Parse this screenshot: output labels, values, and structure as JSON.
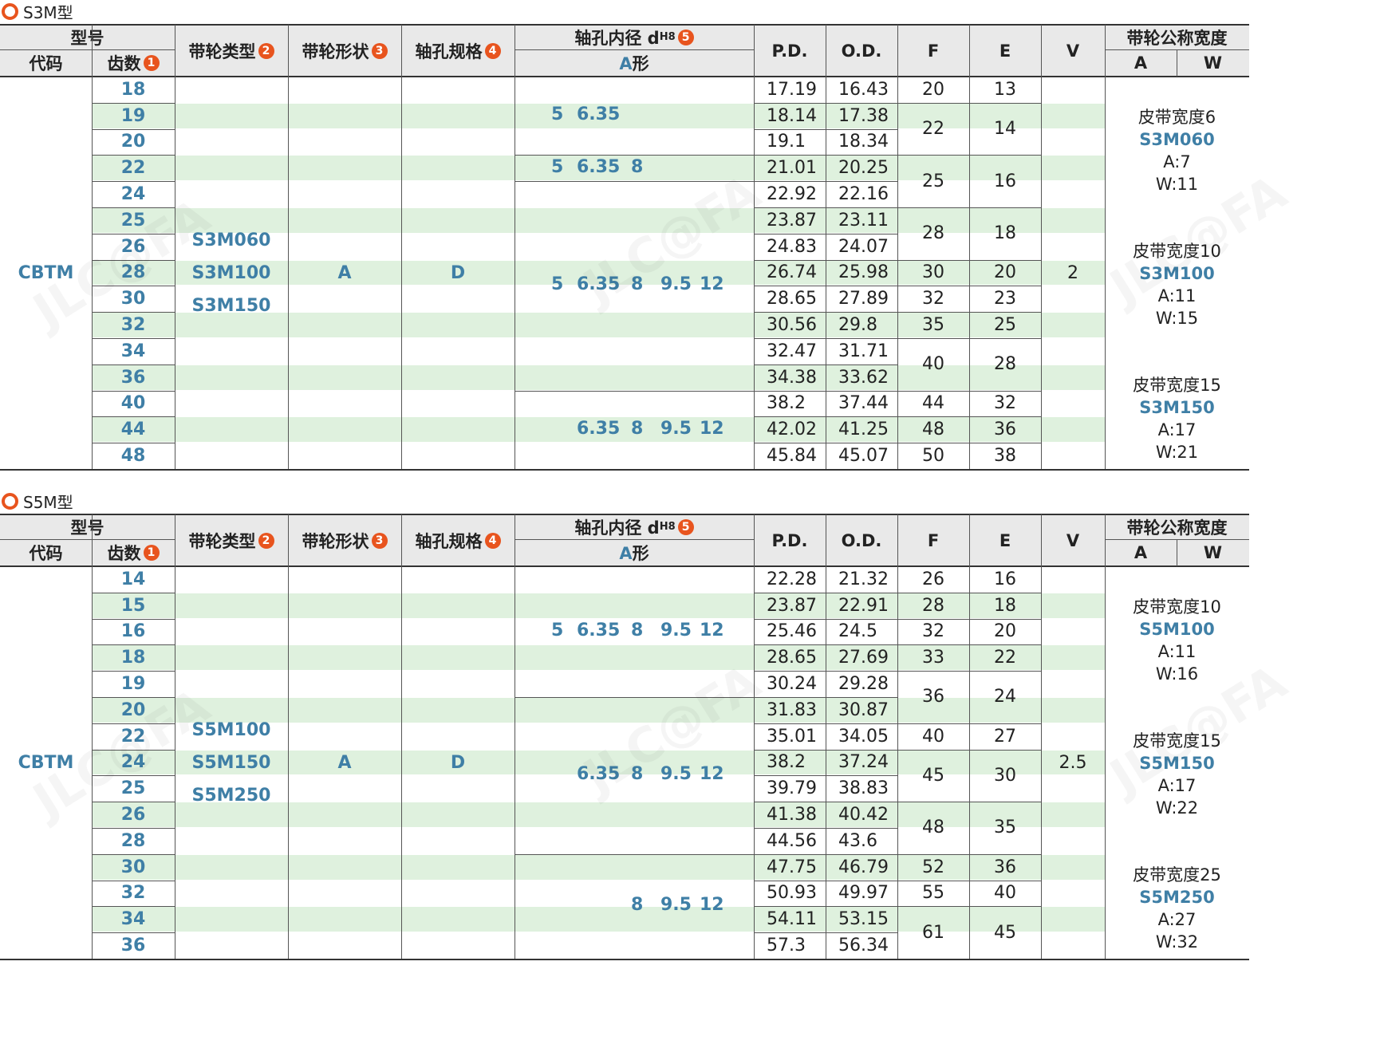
{
  "sections": [
    {
      "title": "S3M型",
      "header": {
        "model": "型号",
        "code": "代码",
        "teeth": "齿数",
        "pulley_type": "带轮类型",
        "pulley_shape": "带轮形状",
        "shaft_spec": "轴孔规格",
        "bore": "轴孔内径 d",
        "bore_sub": "H8",
        "a_shape": "A形",
        "pd": "P.D.",
        "od": "O.D.",
        "f": "F",
        "e": "E",
        "v": "V",
        "nominal_width": "带轮公称宽度",
        "a": "A",
        "w": "W",
        "n1": "1",
        "n2": "2",
        "n3": "3",
        "n4": "4",
        "n5": "5"
      },
      "code": "CBTM",
      "types": [
        "S3M060",
        "S3M100",
        "S3M150"
      ],
      "shape": "A",
      "shaft": "D",
      "v": "2",
      "teeth": [
        "18",
        "19",
        "20",
        "22",
        "24",
        "25",
        "26",
        "28",
        "30",
        "32",
        "34",
        "36",
        "40",
        "44",
        "48"
      ],
      "pd": [
        "17.19",
        "18.14",
        "19.1",
        "21.01",
        "22.92",
        "23.87",
        "24.83",
        "26.74",
        "28.65",
        "30.56",
        "32.47",
        "34.38",
        "38.2",
        "42.02",
        "45.84"
      ],
      "od": [
        "16.43",
        "17.38",
        "18.34",
        "20.25",
        "22.16",
        "23.11",
        "24.07",
        "25.98",
        "27.89",
        "29.8",
        "31.71",
        "33.62",
        "37.44",
        "41.25",
        "45.07"
      ],
      "f": [
        {
          "v": "20",
          "s": 0,
          "n": 1
        },
        {
          "v": "22",
          "s": 1,
          "n": 2
        },
        {
          "v": "25",
          "s": 3,
          "n": 2
        },
        {
          "v": "28",
          "s": 5,
          "n": 2
        },
        {
          "v": "30",
          "s": 7,
          "n": 1
        },
        {
          "v": "32",
          "s": 8,
          "n": 1
        },
        {
          "v": "35",
          "s": 9,
          "n": 1
        },
        {
          "v": "40",
          "s": 10,
          "n": 2
        },
        {
          "v": "44",
          "s": 12,
          "n": 1
        },
        {
          "v": "48",
          "s": 13,
          "n": 1
        },
        {
          "v": "50",
          "s": 14,
          "n": 1
        }
      ],
      "e": [
        {
          "v": "13",
          "s": 0,
          "n": 1
        },
        {
          "v": "14",
          "s": 1,
          "n": 2
        },
        {
          "v": "16",
          "s": 3,
          "n": 2
        },
        {
          "v": "18",
          "s": 5,
          "n": 2
        },
        {
          "v": "20",
          "s": 7,
          "n": 1
        },
        {
          "v": "23",
          "s": 8,
          "n": 1
        },
        {
          "v": "25",
          "s": 9,
          "n": 1
        },
        {
          "v": "28",
          "s": 10,
          "n": 2
        },
        {
          "v": "32",
          "s": 12,
          "n": 1
        },
        {
          "v": "36",
          "s": 13,
          "n": 1
        },
        {
          "v": "38",
          "s": 14,
          "n": 1
        }
      ],
      "bores": [
        {
          "s": 0,
          "n": 3,
          "vals": [
            "5",
            "6.35"
          ]
        },
        {
          "s": 3,
          "n": 1,
          "vals": [
            "5",
            "6.35",
            "8"
          ]
        },
        {
          "s": 4,
          "n": 8,
          "vals": [
            "5",
            "6.35",
            "8",
            "9.5",
            "12"
          ]
        },
        {
          "s": 12,
          "n": 3,
          "vals": [
            "6.35",
            "8",
            "9.5",
            "12"
          ]
        }
      ],
      "widths": [
        {
          "label": "皮带宽度6",
          "model": "S3M060",
          "a": "A:7",
          "w": "W:11"
        },
        {
          "label": "皮带宽度10",
          "model": "S3M100",
          "a": "A:11",
          "w": "W:15"
        },
        {
          "label": "皮带宽度15",
          "model": "S3M150",
          "a": "A:17",
          "w": "W:21"
        }
      ]
    },
    {
      "title": "S5M型",
      "header": {
        "model": "型号",
        "code": "代码",
        "teeth": "齿数",
        "pulley_type": "带轮类型",
        "pulley_shape": "带轮形状",
        "shaft_spec": "轴孔规格",
        "bore": "轴孔内径 d",
        "bore_sub": "H8",
        "a_shape": "A形",
        "pd": "P.D.",
        "od": "O.D.",
        "f": "F",
        "e": "E",
        "v": "V",
        "nominal_width": "带轮公称宽度",
        "a": "A",
        "w": "W",
        "n1": "1",
        "n2": "2",
        "n3": "3",
        "n4": "4",
        "n5": "5"
      },
      "code": "CBTM",
      "types": [
        "S5M100",
        "S5M150",
        "S5M250"
      ],
      "shape": "A",
      "shaft": "D",
      "v": "2.5",
      "teeth": [
        "14",
        "15",
        "16",
        "18",
        "19",
        "20",
        "22",
        "24",
        "25",
        "26",
        "28",
        "30",
        "32",
        "34",
        "36"
      ],
      "pd": [
        "22.28",
        "23.87",
        "25.46",
        "28.65",
        "30.24",
        "31.83",
        "35.01",
        "38.2",
        "39.79",
        "41.38",
        "44.56",
        "47.75",
        "50.93",
        "54.11",
        "57.3"
      ],
      "od": [
        "21.32",
        "22.91",
        "24.5",
        "27.69",
        "29.28",
        "30.87",
        "34.05",
        "37.24",
        "38.83",
        "40.42",
        "43.6",
        "46.79",
        "49.97",
        "53.15",
        "56.34"
      ],
      "f": [
        {
          "v": "26",
          "s": 0,
          "n": 1
        },
        {
          "v": "28",
          "s": 1,
          "n": 1
        },
        {
          "v": "32",
          "s": 2,
          "n": 1
        },
        {
          "v": "33",
          "s": 3,
          "n": 1
        },
        {
          "v": "36",
          "s": 4,
          "n": 2
        },
        {
          "v": "40",
          "s": 6,
          "n": 1
        },
        {
          "v": "45",
          "s": 7,
          "n": 2
        },
        {
          "v": "48",
          "s": 9,
          "n": 2
        },
        {
          "v": "52",
          "s": 11,
          "n": 1
        },
        {
          "v": "55",
          "s": 12,
          "n": 1
        },
        {
          "v": "61",
          "s": 13,
          "n": 2
        }
      ],
      "e": [
        {
          "v": "16",
          "s": 0,
          "n": 1
        },
        {
          "v": "18",
          "s": 1,
          "n": 1
        },
        {
          "v": "20",
          "s": 2,
          "n": 1
        },
        {
          "v": "22",
          "s": 3,
          "n": 1
        },
        {
          "v": "24",
          "s": 4,
          "n": 2
        },
        {
          "v": "27",
          "s": 6,
          "n": 1
        },
        {
          "v": "30",
          "s": 7,
          "n": 2
        },
        {
          "v": "35",
          "s": 9,
          "n": 2
        },
        {
          "v": "36",
          "s": 11,
          "n": 1
        },
        {
          "v": "40",
          "s": 12,
          "n": 1
        },
        {
          "v": "45",
          "s": 13,
          "n": 2
        }
      ],
      "bores": [
        {
          "s": 0,
          "n": 5,
          "vals": [
            "5",
            "6.35",
            "8",
            "9.5",
            "12"
          ]
        },
        {
          "s": 5,
          "n": 6,
          "vals": [
            "6.35",
            "8",
            "9.5",
            "12"
          ]
        },
        {
          "s": 11,
          "n": 4,
          "vals": [
            "8",
            "9.5",
            "12"
          ]
        }
      ],
      "widths": [
        {
          "label": "皮带宽度10",
          "model": "S5M100",
          "a": "A:11",
          "w": "W:16"
        },
        {
          "label": "皮带宽度15",
          "model": "S5M150",
          "a": "A:17",
          "w": "W:22"
        },
        {
          "label": "皮带宽度25",
          "model": "S5M250",
          "a": "A:27",
          "w": "W:32"
        }
      ]
    }
  ],
  "watermark": "JLC@FA"
}
